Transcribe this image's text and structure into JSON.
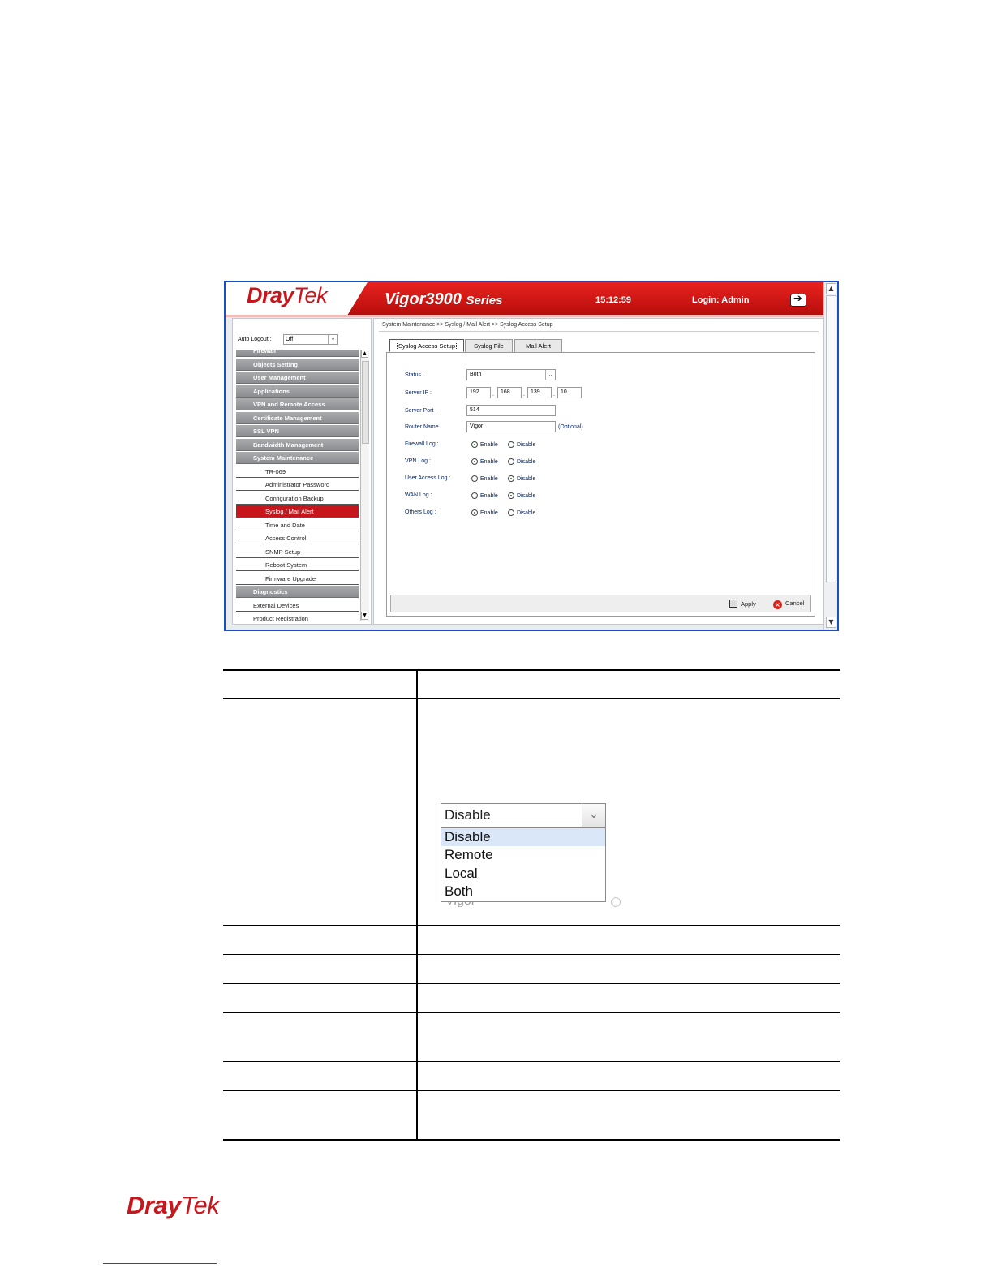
{
  "screenshot": {
    "header": {
      "brand_a": "Dray",
      "brand_b": "Tek",
      "model": "Vigor3900",
      "series": "Series",
      "time": "15:12:59",
      "login": "Login: Admin"
    },
    "sidebar": {
      "auto_logout_label": "Auto Logout :",
      "auto_logout_value": "Off",
      "items": [
        {
          "label": "Firewall",
          "kind": "cat"
        },
        {
          "label": "Objects Setting",
          "kind": "cat"
        },
        {
          "label": "User Management",
          "kind": "cat"
        },
        {
          "label": "Applications",
          "kind": "cat"
        },
        {
          "label": "VPN and Remote Access",
          "kind": "cat"
        },
        {
          "label": "Certificate Management",
          "kind": "cat"
        },
        {
          "label": "SSL VPN",
          "kind": "cat"
        },
        {
          "label": "Bandwidth Management",
          "kind": "cat"
        },
        {
          "label": "System Maintenance",
          "kind": "cat"
        },
        {
          "label": "TR-069",
          "kind": "sub"
        },
        {
          "label": "Administrator Password",
          "kind": "sub"
        },
        {
          "label": "Configuration Backup",
          "kind": "sub"
        },
        {
          "label": "Syslog / Mail Alert",
          "kind": "active"
        },
        {
          "label": "Time and Date",
          "kind": "sub"
        },
        {
          "label": "Access Control",
          "kind": "sub"
        },
        {
          "label": "SNMP Setup",
          "kind": "sub"
        },
        {
          "label": "Reboot System",
          "kind": "sub"
        },
        {
          "label": "Firmware Upgrade",
          "kind": "sub"
        },
        {
          "label": "Diagnostics",
          "kind": "cat"
        },
        {
          "label": "External Devices",
          "kind": "plain"
        },
        {
          "label": "Product Registration",
          "kind": "plain"
        }
      ]
    },
    "breadcrumb": "System Maintenance >> Syslog / Mail Alert >> Syslog Access Setup",
    "tabs": [
      "Syslog Access Setup",
      "Syslog File",
      "Mail Alert"
    ],
    "form": {
      "status_label": "Status :",
      "status_value": "Both",
      "server_ip_label": "Server IP :",
      "ip": [
        "192",
        "168",
        "139",
        "10"
      ],
      "server_port_label": "Server Port :",
      "server_port_value": "514",
      "router_name_label": "Router Name :",
      "router_name_value": "Vigor",
      "optional": "(Optional)",
      "enable": "Enable",
      "disable": "Disable",
      "logs": [
        {
          "label": "Firewall Log :",
          "value": "Enable"
        },
        {
          "label": "VPN Log :",
          "value": "Enable"
        },
        {
          "label": "User Access Log :",
          "value": "Disable"
        },
        {
          "label": "WAN Log :",
          "value": "Disable"
        },
        {
          "label": "Others Log :",
          "value": "Enable"
        }
      ]
    },
    "buttons": {
      "apply": "Apply",
      "cancel": "Cancel"
    }
  },
  "dropdown_illustration": {
    "selected": "Disable",
    "options": [
      "Disable",
      "Remote",
      "Local",
      "Both"
    ],
    "peek_text": "Vigor"
  },
  "footer": {
    "brand_a": "Dray",
    "brand_b": "Tek"
  }
}
